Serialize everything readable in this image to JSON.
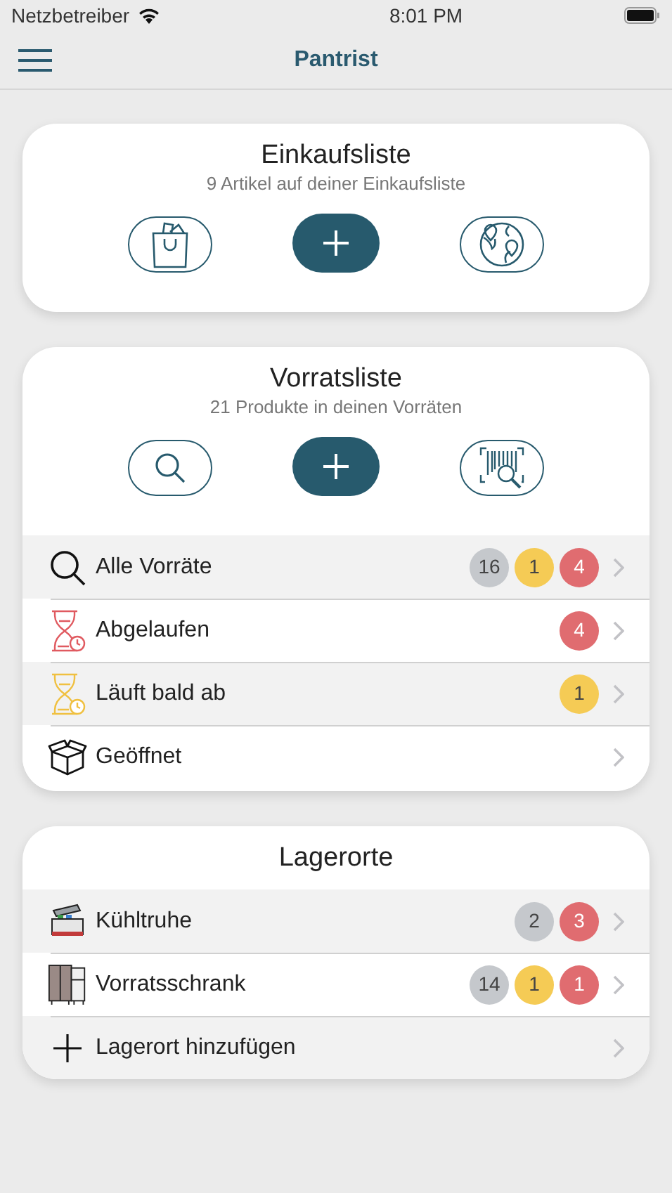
{
  "status_bar": {
    "carrier": "Netzbetreiber",
    "time": "8:01 PM"
  },
  "nav": {
    "title": "Pantrist"
  },
  "shopping": {
    "title": "Einkaufsliste",
    "subtitle": "9 Artikel auf deiner Einkaufsliste",
    "buttons": [
      {
        "kind": "bag"
      },
      {
        "kind": "add"
      },
      {
        "kind": "map"
      }
    ]
  },
  "pantry": {
    "title": "Vorratsliste",
    "subtitle": "21 Produkte in deinen Vorräten",
    "buttons": [
      {
        "kind": "search"
      },
      {
        "kind": "add"
      },
      {
        "kind": "barcode"
      }
    ],
    "rows": [
      {
        "kind": "all",
        "label": "Alle Vorräte",
        "badges": [
          {
            "count": "16",
            "color": "#c5c8cc"
          },
          {
            "count": "1",
            "color": "#f5cb55"
          },
          {
            "count": "4",
            "color": "#e06c70"
          }
        ]
      },
      {
        "kind": "expired",
        "label": "Abgelaufen",
        "badges": [
          {
            "count": "4",
            "color": "#e06c70"
          }
        ]
      },
      {
        "kind": "expiring",
        "label": "Läuft bald ab",
        "badges": [
          {
            "count": "1",
            "color": "#f5cb55"
          }
        ]
      },
      {
        "kind": "opened",
        "label": "Geöffnet",
        "badges": []
      }
    ]
  },
  "storage": {
    "title": "Lagerorte",
    "rows": [
      {
        "kind": "freezer",
        "label": "Kühltruhe",
        "badges": [
          {
            "count": "2",
            "color": "#c5c8cc"
          },
          {
            "count": "3",
            "color": "#e06c70"
          }
        ]
      },
      {
        "kind": "cabinet",
        "label": "Vorratsschrank",
        "badges": [
          {
            "count": "14",
            "color": "#c5c8cc"
          },
          {
            "count": "1",
            "color": "#f5cb55"
          },
          {
            "count": "1",
            "color": "#e06c70"
          }
        ]
      },
      {
        "kind": "add",
        "label": "Lagerort hinzufügen",
        "badges": []
      }
    ]
  }
}
